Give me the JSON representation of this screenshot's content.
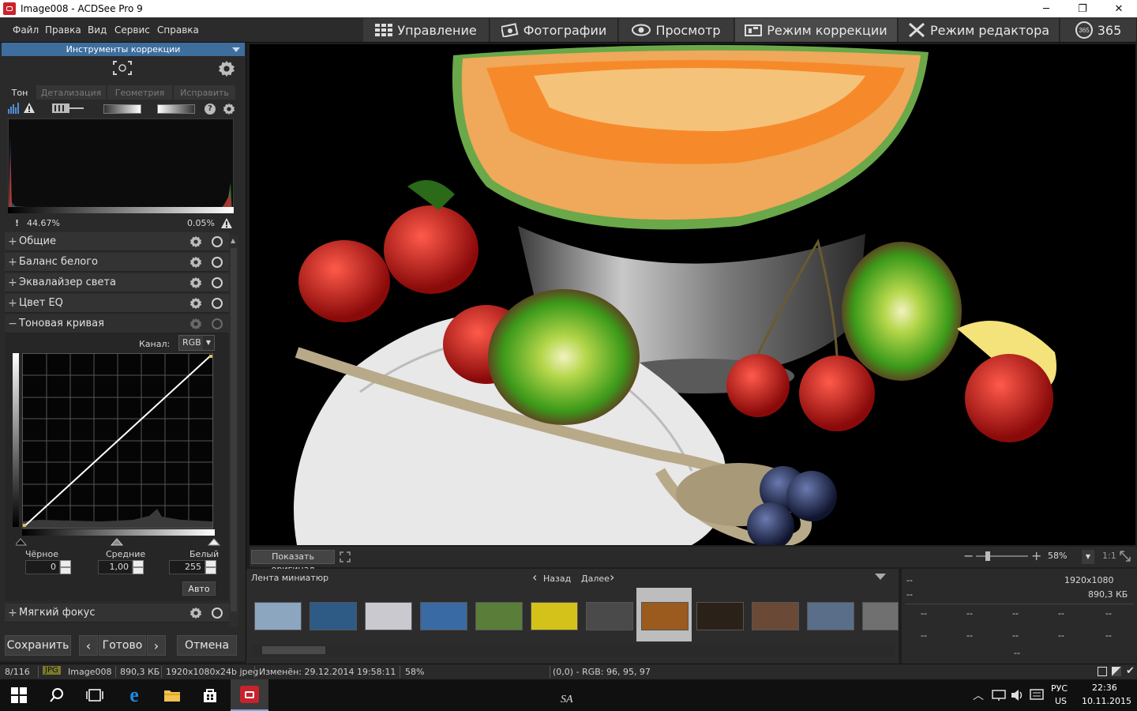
{
  "window": {
    "title": "Image008 - ACDSee Pro 9",
    "minimize": "─",
    "maximize": "❐",
    "close": "✕"
  },
  "menu": [
    "Файл",
    "Правка",
    "Вид",
    "Сервис",
    "Справка"
  ],
  "modes": [
    {
      "label": "Управление",
      "icon": "grid-icon"
    },
    {
      "label": "Фотографии",
      "icon": "photos-icon"
    },
    {
      "label": "Просмотр",
      "icon": "eye-icon"
    },
    {
      "label": "Режим коррекции",
      "icon": "develop-icon",
      "active": true
    },
    {
      "label": "Режим редактора",
      "icon": "edit-tools-icon"
    },
    {
      "label": "365",
      "icon": "365-icon"
    }
  ],
  "panel": {
    "title": "Инструменты коррекции",
    "tabs": [
      "Тон",
      "Детализация",
      "Геометрия",
      "Исправить"
    ],
    "histogram": {
      "left_pct": "44.67%",
      "right_pct": "0.05%",
      "left_marker": "!"
    },
    "sections": [
      {
        "label": "Общие",
        "expanded": false
      },
      {
        "label": "Баланс белого",
        "expanded": false
      },
      {
        "label": "Эквалайзер света",
        "expanded": false
      },
      {
        "label": "Цвет EQ",
        "expanded": false
      },
      {
        "label": "Тоновая кривая",
        "expanded": true
      }
    ],
    "curve": {
      "channel_label": "Канал:",
      "channel_value": "RGB",
      "black_label": "Чёрное",
      "black_value": "0",
      "mid_label": "Средние",
      "mid_value": "1,00",
      "white_label": "Белый",
      "white_value": "255",
      "auto_label": "Авто"
    },
    "soft_focus": "Мягкий фокус",
    "save": "Сохранить",
    "done": "Готово",
    "cancel": "Отмена"
  },
  "viewer": {
    "show_original": "Показать оригинал",
    "zoom": "58%",
    "ratio": "1:1"
  },
  "filmstrip": {
    "title": "Лента миниатюр",
    "back": "Назад",
    "next": "Далее",
    "thumbs": [
      {
        "color": "#8da6c0"
      },
      {
        "color": "#2e5a86"
      },
      {
        "color": "#c9c9cf"
      },
      {
        "color": "#3a6aa4"
      },
      {
        "color": "#5b7d3a"
      },
      {
        "color": "#d4c21a"
      },
      {
        "color": "#4a4a4a"
      },
      {
        "color": "#9b5a1e",
        "selected": true
      },
      {
        "color": "#2a2218"
      },
      {
        "color": "#6a4a36"
      },
      {
        "color": "#5a6e8a"
      },
      {
        "color": "#707070"
      }
    ]
  },
  "info": {
    "dash": "--",
    "dims": "1920x1080",
    "size": "890,3 КБ"
  },
  "status": {
    "index": "8/116",
    "format": "JPG",
    "filename": "Image008",
    "filesize": "890,3 КБ",
    "details": "1920x1080x24b jpeg",
    "modified": "Изменён: 29.12.2014 19:58:11",
    "zoom": "58%",
    "pixel": "(0,0) - RGB: 96, 95, 97"
  },
  "taskbar": {
    "lang": "РУС",
    "layout": "US",
    "time": "22:36",
    "date": "10.11.2015",
    "watermark": "SA"
  }
}
